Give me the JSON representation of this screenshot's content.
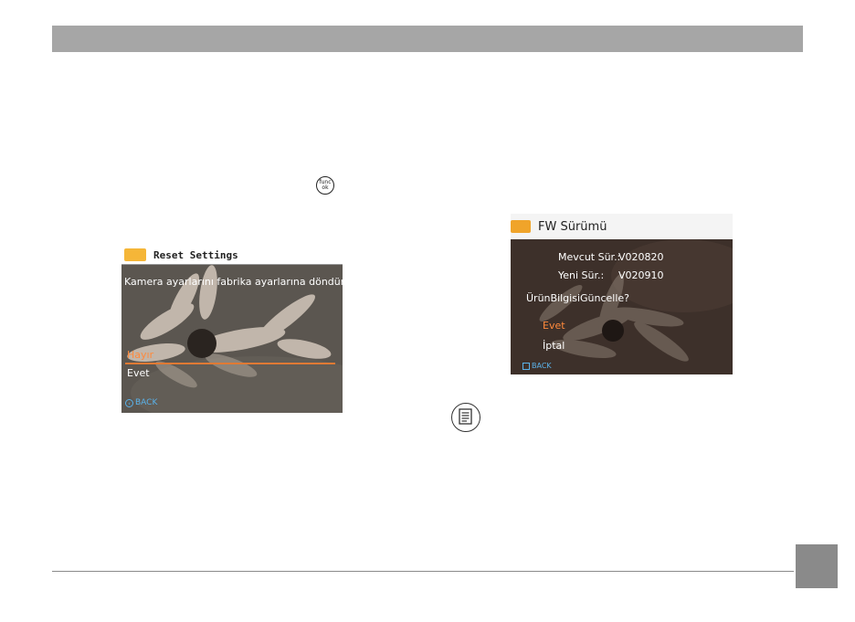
{
  "left_screen": {
    "title": "Reset Settings",
    "message": "Kamera ayarlarını fabrika ayarlarına döndür.",
    "options": [
      "Hayır",
      "Evet"
    ],
    "selected_index": 0,
    "back_label": "BACK"
  },
  "right_screen": {
    "title": "FW Sürümü",
    "current_version_label": "Mevcut Sür.:",
    "current_version_value": "V020820",
    "new_version_label": "Yeni Sür.:",
    "new_version_value": "V020910",
    "question": "ÜrünBilgisiGüncelle?",
    "options": [
      "Evet",
      "İptal"
    ],
    "selected_index": 0,
    "back_label": "BACK"
  },
  "func_button": {
    "line1": "func",
    "line2": "ok"
  },
  "icons": [
    "func-ok-button-icon",
    "camera-icon",
    "back-icon",
    "note-icon"
  ],
  "colors": {
    "header_bar": "#a6a6a6",
    "highlight": "#ff8a3c",
    "back_text": "#5ab2ea",
    "camera_icon": "#f5b638"
  }
}
